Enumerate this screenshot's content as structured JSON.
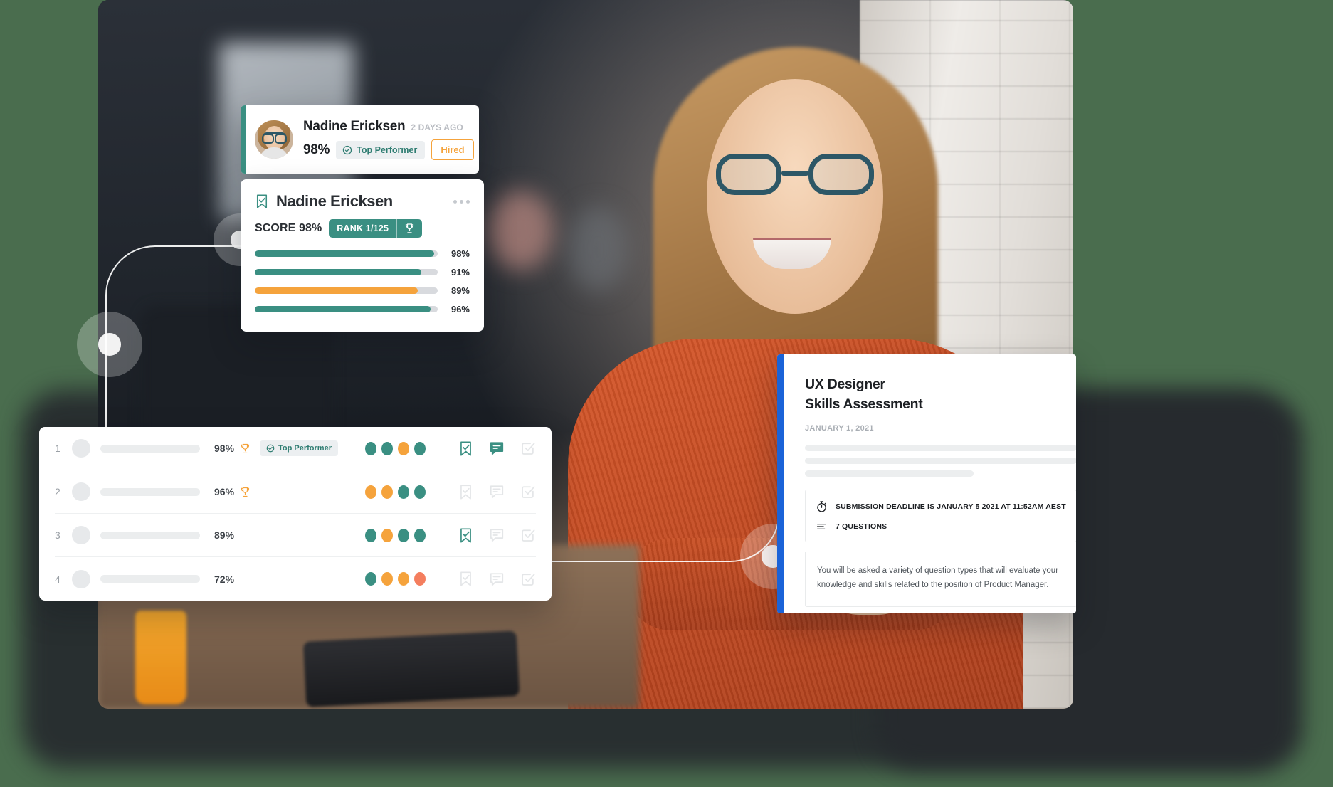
{
  "theme": {
    "background": "#4a6d4e",
    "teal": "#3a8f82",
    "orange": "#f5a33c",
    "coral": "#f47e5e",
    "blue": "#1a63d8",
    "ink": "#1d2024",
    "muted": "#b9bcc2",
    "track": "#d8dade"
  },
  "notification": {
    "name": "Nadine Ericksen",
    "time_ago": "2 DAYS AGO",
    "score": "98%",
    "badge_label": "Top Performer",
    "badge_icon": "check-circle-icon",
    "action_label": "Hired",
    "avatar_icon": "avatar"
  },
  "score_card": {
    "name": "Nadine Ericksen",
    "bookmark_icon": "bookmark-check-icon",
    "menu_icon": "more-horizontal-icon",
    "score_label": "SCORE",
    "score_value": "98%",
    "rank_label": "RANK 1/125",
    "rank_icon": "trophy-icon",
    "bars": [
      {
        "value": 98,
        "label": "98%",
        "color": "#3a8f82"
      },
      {
        "value": 91,
        "label": "91%",
        "color": "#3a8f82"
      },
      {
        "value": 89,
        "label": "89%",
        "color": "#f5a33c"
      },
      {
        "value": 96,
        "label": "96%",
        "color": "#3a8f82"
      }
    ]
  },
  "leaderboard": {
    "rows": [
      {
        "rank": "1",
        "score": "98%",
        "trophy": true,
        "badge_label": "Top Performer",
        "badge_icon": "check-circle-icon",
        "dots": [
          "#3a8f82",
          "#3a8f82",
          "#f5a33c",
          "#3a8f82"
        ],
        "actions": [
          {
            "icon": "bookmark-check-icon",
            "active": true
          },
          {
            "icon": "comment-icon",
            "active": true
          },
          {
            "icon": "check-square-icon",
            "active": false
          }
        ]
      },
      {
        "rank": "2",
        "score": "96%",
        "trophy": true,
        "badge_label": "",
        "badge_icon": "",
        "dots": [
          "#f5a33c",
          "#f5a33c",
          "#3a8f82",
          "#3a8f82"
        ],
        "actions": [
          {
            "icon": "bookmark-check-icon",
            "active": false
          },
          {
            "icon": "comment-icon",
            "active": false
          },
          {
            "icon": "check-square-icon",
            "active": false
          }
        ]
      },
      {
        "rank": "3",
        "score": "89%",
        "trophy": false,
        "badge_label": "",
        "badge_icon": "",
        "dots": [
          "#3a8f82",
          "#f5a33c",
          "#3a8f82",
          "#3a8f82"
        ],
        "actions": [
          {
            "icon": "bookmark-check-icon",
            "active": true
          },
          {
            "icon": "comment-icon",
            "active": false
          },
          {
            "icon": "check-square-icon",
            "active": false
          }
        ]
      },
      {
        "rank": "4",
        "score": "72%",
        "trophy": false,
        "badge_label": "",
        "badge_icon": "",
        "dots": [
          "#3a8f82",
          "#f5a33c",
          "#f5a33c",
          "#f47e5e"
        ],
        "actions": [
          {
            "icon": "bookmark-check-icon",
            "active": false
          },
          {
            "icon": "comment-icon",
            "active": false
          },
          {
            "icon": "check-square-icon",
            "active": false
          }
        ]
      }
    ]
  },
  "assessment": {
    "title_line1": "UX Designer",
    "title_line2": "Skills Assessment",
    "date": "JANUARY 1, 2021",
    "deadline_icon": "stopwatch-icon",
    "deadline_text": "SUBMISSION DEADLINE IS JANUARY 5 2021 AT 11:52AM AEST",
    "questions_icon": "list-icon",
    "questions_text": "7 QUESTIONS",
    "description": "You will be asked a variety of question types that will evaluate your knowledge and skills related to the position of Product Manager."
  }
}
